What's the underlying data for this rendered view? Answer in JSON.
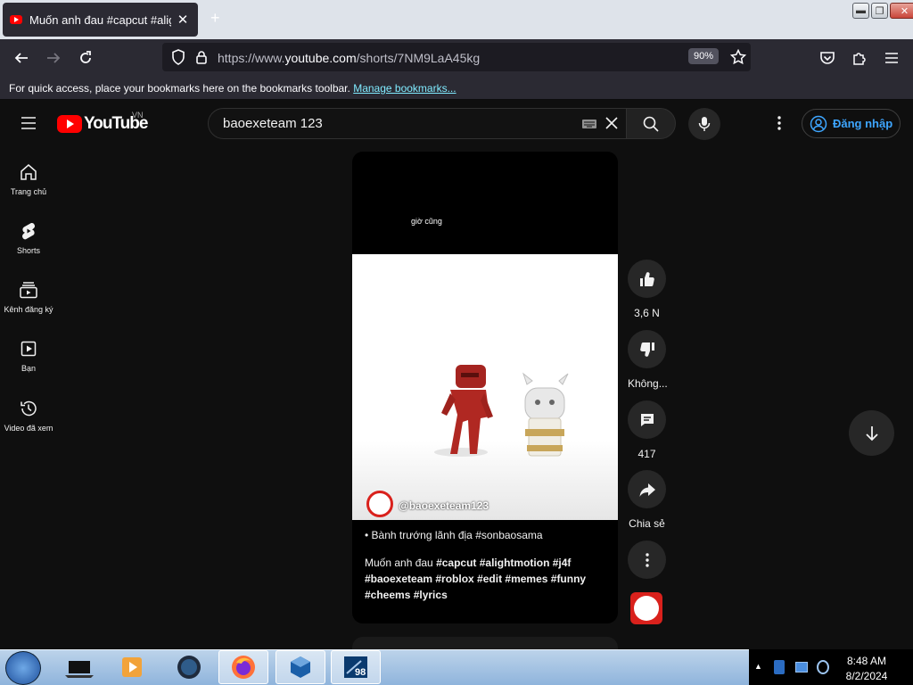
{
  "browser": {
    "tab_title": "Muốn anh đau #capcut #alight",
    "new_tab": "+",
    "url_prefix": "https://www.",
    "url_domain": "youtube.com",
    "url_path": "/shorts/7NM9LaA45kg",
    "zoom": "90%",
    "bookmarks_text": "For quick access, place your bookmarks here on the bookmarks toolbar.",
    "bookmarks_link": "Manage bookmarks..."
  },
  "youtube": {
    "logo_text": "YouTube",
    "country": "VN",
    "search_value": "baoexeteam 123",
    "signin_label": "Đăng nhập"
  },
  "sidebar": {
    "items": [
      {
        "label": "Trang chủ",
        "icon": "home-icon"
      },
      {
        "label": "Shorts",
        "icon": "shorts-icon"
      },
      {
        "label": "Kênh đăng ký",
        "icon": "subscriptions-icon"
      },
      {
        "label": "Bạn",
        "icon": "you-icon"
      },
      {
        "label": "Video đã xem",
        "icon": "history-icon"
      }
    ]
  },
  "short": {
    "top_caption": "giờ cũng",
    "channel_handle": "@baoexeteam123",
    "tag_line": "Bành trướng lãnh địa #sonbaosama",
    "desc_plain": "Muốn anh đau ",
    "desc_tags": "#capcut #alightmotion #j4f #baoexeteam #roblox #edit #memes #funny #cheems #lyrics"
  },
  "actions": {
    "likes": "3,6 N",
    "dislike": "Không...",
    "comments": "417",
    "share": "Chia sẻ"
  },
  "taskbar": {
    "time": "8:48 AM",
    "date": "8/2/2024",
    "badge": "98"
  },
  "colors": {
    "youtube_red": "#ff0000",
    "link_blue": "#3ea6ff",
    "taskbar": "#9fbfe2"
  }
}
